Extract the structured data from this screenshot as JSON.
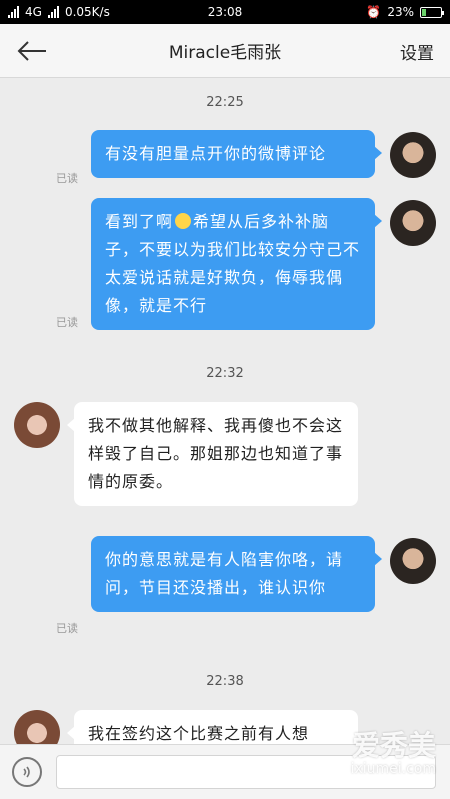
{
  "status_bar": {
    "network": "4G",
    "speed": "0.05K/s",
    "time": "23:08",
    "battery": "23%",
    "battery_level": 0.23
  },
  "header": {
    "title": "Miracle毛雨张",
    "settings_label": "设置"
  },
  "messages": [
    {
      "timestamp": "22:25"
    },
    {
      "side": "out",
      "read": "已读",
      "text": "有没有胆量点开你的微博评论"
    },
    {
      "side": "out",
      "read": "已读",
      "text_before_emoji": "看到了啊",
      "text_after_emoji": "希望从后多补补脑子，不要以为我们比较安分守己不太爱说话就是好欺负，侮辱我偶像，就是不行"
    },
    {
      "timestamp": "22:32"
    },
    {
      "side": "in",
      "text": "我不做其他解释、我再傻也不会这样毁了自己。那姐那边也知道了事情的原委。"
    },
    {
      "side": "out",
      "read": "已读",
      "text": "你的意思就是有人陷害你咯，请问，节目还没播出，谁认识你"
    },
    {
      "timestamp": "22:38"
    },
    {
      "side": "in",
      "text": "我在签约这个比赛之前有人想"
    }
  ],
  "input": {
    "placeholder": ""
  },
  "watermark": {
    "brand": "爱秀美",
    "domain": "ixiumei.com"
  },
  "colors": {
    "outgoing_bubble": "#3d9cf2",
    "incoming_bubble": "#ffffff",
    "background": "#ececec"
  }
}
